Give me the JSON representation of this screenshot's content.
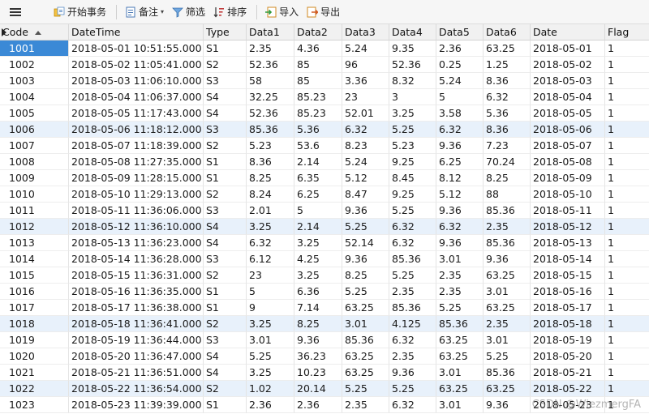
{
  "toolbar": {
    "begin_transaction": "开始事务",
    "note": "备注",
    "filter": "筛选",
    "sort": "排序",
    "import": "导入",
    "export": "导出"
  },
  "columns": [
    "Code",
    "DateTime",
    "Type",
    "Data1",
    "Data2",
    "Data3",
    "Data4",
    "Data5",
    "Data6",
    "Date",
    "Flag"
  ],
  "rows": [
    [
      "1001",
      "2018-05-01 10:51:55.000",
      "S1",
      "2.35",
      "4.36",
      "5.24",
      "9.35",
      "2.36",
      "63.25",
      "2018-05-01",
      "1"
    ],
    [
      "1002",
      "2018-05-02 11:05:41.000",
      "S2",
      "52.36",
      "85",
      "96",
      "52.36",
      "0.25",
      "1.25",
      "2018-05-02",
      "1"
    ],
    [
      "1003",
      "2018-05-03 11:06:10.000",
      "S3",
      "58",
      "85",
      "3.36",
      "8.32",
      "5.24",
      "8.36",
      "2018-05-03",
      "1"
    ],
    [
      "1004",
      "2018-05-04 11:06:37.000",
      "S4",
      "32.25",
      "85.23",
      "23",
      "3",
      "5",
      "6.32",
      "2018-05-04",
      "1"
    ],
    [
      "1005",
      "2018-05-05 11:17:43.000",
      "S4",
      "52.36",
      "85.23",
      "52.01",
      "3.25",
      "3.58",
      "5.36",
      "2018-05-05",
      "1"
    ],
    [
      "1006",
      "2018-05-06 11:18:12.000",
      "S3",
      "85.36",
      "5.36",
      "6.32",
      "5.25",
      "6.32",
      "8.36",
      "2018-05-06",
      "1"
    ],
    [
      "1007",
      "2018-05-07 11:18:39.000",
      "S2",
      "5.23",
      "53.6",
      "8.23",
      "5.23",
      "9.36",
      "7.23",
      "2018-05-07",
      "1"
    ],
    [
      "1008",
      "2018-05-08 11:27:35.000",
      "S1",
      "8.36",
      "2.14",
      "5.24",
      "9.25",
      "6.25",
      "70.24",
      "2018-05-08",
      "1"
    ],
    [
      "1009",
      "2018-05-09 11:28:15.000",
      "S1",
      "8.25",
      "6.35",
      "5.12",
      "8.45",
      "8.12",
      "8.25",
      "2018-05-09",
      "1"
    ],
    [
      "1010",
      "2018-05-10 11:29:13.000",
      "S2",
      "8.24",
      "6.25",
      "8.47",
      "9.25",
      "5.12",
      "88",
      "2018-05-10",
      "1"
    ],
    [
      "1011",
      "2018-05-11 11:36:06.000",
      "S3",
      "2.01",
      "5",
      "9.36",
      "5.25",
      "9.36",
      "85.36",
      "2018-05-11",
      "1"
    ],
    [
      "1012",
      "2018-05-12 11:36:10.000",
      "S4",
      "3.25",
      "2.14",
      "5.25",
      "6.32",
      "6.32",
      "2.35",
      "2018-05-12",
      "1"
    ],
    [
      "1013",
      "2018-05-13 11:36:23.000",
      "S4",
      "6.32",
      "3.25",
      "52.14",
      "6.32",
      "9.36",
      "85.36",
      "2018-05-13",
      "1"
    ],
    [
      "1014",
      "2018-05-14 11:36:28.000",
      "S3",
      "6.12",
      "4.25",
      "9.36",
      "85.36",
      "3.01",
      "9.36",
      "2018-05-14",
      "1"
    ],
    [
      "1015",
      "2018-05-15 11:36:31.000",
      "S2",
      "23",
      "3.25",
      "8.25",
      "5.25",
      "2.35",
      "63.25",
      "2018-05-15",
      "1"
    ],
    [
      "1016",
      "2018-05-16 11:36:35.000",
      "S1",
      "5",
      "6.36",
      "5.25",
      "2.35",
      "2.35",
      "3.01",
      "2018-05-16",
      "1"
    ],
    [
      "1017",
      "2018-05-17 11:36:38.000",
      "S1",
      "9",
      "7.14",
      "63.25",
      "85.36",
      "5.25",
      "63.25",
      "2018-05-17",
      "1"
    ],
    [
      "1018",
      "2018-05-18 11:36:41.000",
      "S2",
      "3.25",
      "8.25",
      "3.01",
      "4.125",
      "85.36",
      "2.35",
      "2018-05-18",
      "1"
    ],
    [
      "1019",
      "2018-05-19 11:36:44.000",
      "S3",
      "3.01",
      "9.36",
      "85.36",
      "6.32",
      "63.25",
      "3.01",
      "2018-05-19",
      "1"
    ],
    [
      "1020",
      "2018-05-20 11:36:47.000",
      "S4",
      "5.25",
      "36.23",
      "63.25",
      "2.35",
      "63.25",
      "5.25",
      "2018-05-20",
      "1"
    ],
    [
      "1021",
      "2018-05-21 11:36:51.000",
      "S4",
      "3.25",
      "10.23",
      "63.25",
      "9.36",
      "3.01",
      "85.36",
      "2018-05-21",
      "1"
    ],
    [
      "1022",
      "2018-05-22 11:36:54.000",
      "S2",
      "1.02",
      "20.14",
      "5.25",
      "5.25",
      "63.25",
      "63.25",
      "2018-05-22",
      "1"
    ],
    [
      "1023",
      "2018-05-23 11:39:39.000",
      "S1",
      "2.36",
      "2.36",
      "2.35",
      "6.32",
      "3.01",
      "9.36",
      "2018-05-23",
      "1"
    ]
  ],
  "watermark": "CSDN @WiezmergFA",
  "colors": {
    "selection": "#3b89d6",
    "header_bg": "#f1f1f1",
    "stripe": "#e8f1fb"
  }
}
